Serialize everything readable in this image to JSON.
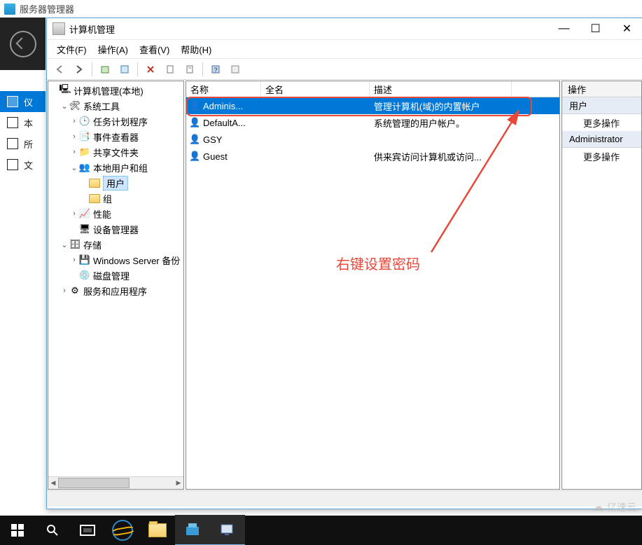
{
  "bg": {
    "title": "服务器管理器",
    "nav": [
      "仪",
      "本",
      "所",
      "文"
    ]
  },
  "cm": {
    "title": "计算机管理",
    "winbtn": {
      "min": "—",
      "max": "☐",
      "close": "✕"
    },
    "menu": {
      "file": "文件(F)",
      "action": "操作(A)",
      "view": "查看(V)",
      "help": "帮助(H)"
    },
    "tree": {
      "root": "计算机管理(本地)",
      "systools": "系统工具",
      "tasksched": "任务计划程序",
      "eventviewer": "事件查看器",
      "sharedfolders": "共享文件夹",
      "localusers": "本地用户和组",
      "users": "用户",
      "groups": "组",
      "performance": "性能",
      "devmgr": "设备管理器",
      "storage": "存储",
      "wsb": "Windows Server 备份",
      "diskmgmt": "磁盘管理",
      "services": "服务和应用程序"
    },
    "list": {
      "col_name": "名称",
      "col_fullname": "全名",
      "col_desc": "描述",
      "rows": [
        {
          "name": "Adminis...",
          "full": "",
          "desc": "管理计算机(域)的内置帐户"
        },
        {
          "name": "DefaultA...",
          "full": "",
          "desc": "系统管理的用户帐户。"
        },
        {
          "name": "GSY",
          "full": "",
          "desc": ""
        },
        {
          "name": "Guest",
          "full": "",
          "desc": "供来宾访问计算机或访问..."
        }
      ]
    },
    "actions": {
      "header": "操作",
      "group1": "用户",
      "more1": "更多操作",
      "group2": "Administrator",
      "more2": "更多操作"
    },
    "annotation": "右键设置密码"
  },
  "watermark": "亿速云"
}
